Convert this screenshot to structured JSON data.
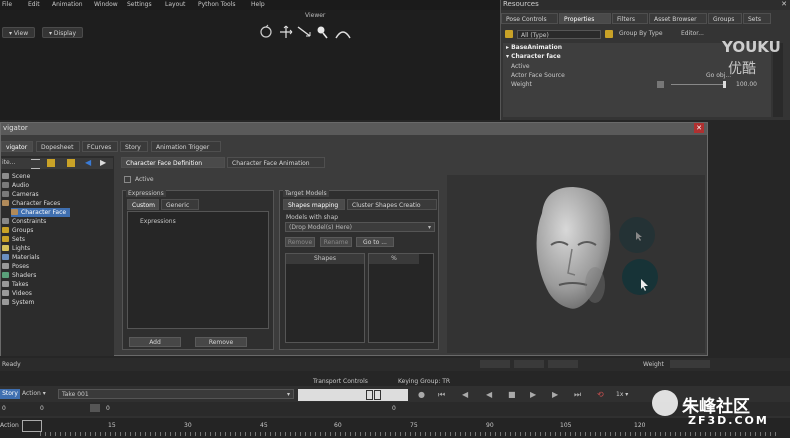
{
  "menu": [
    "File",
    "Edit",
    "Animation",
    "Window",
    "Settings",
    "Layout",
    "Python Tools",
    "Help"
  ],
  "viewer": {
    "title": "Viewer",
    "view_label": "View",
    "display_label": "Display"
  },
  "resources": {
    "title": "Resources",
    "tabs": [
      "Pose Controls",
      "Properties",
      "Filters",
      "Asset Browser",
      "Groups",
      "Sets"
    ],
    "filter_value": "All (Type)",
    "group_value": "Group By Type",
    "editor_label": "Editor...",
    "rows": {
      "base_animation": "BaseAnimation",
      "character_face": "Character face",
      "active": "Active",
      "actor_face_source": "Actor Face Source",
      "actor_face_value": "Go obj...",
      "weight": "Weight",
      "weight_value": "100.00"
    }
  },
  "watermark": {
    "youku_latin": "YOUKU",
    "youku_cn": "优酷",
    "zf3d_cn": "朱峰社区",
    "zf3d_url": "ZF3D.COM"
  },
  "navigator": {
    "title": "vigator",
    "tabs": [
      "vigator",
      "Dopesheet",
      "FCurves",
      "Story",
      "Animation Trigger"
    ],
    "search_label": "ite...",
    "tree": [
      "Scene",
      "Audio",
      "Cameras",
      "Character Faces",
      "Character Face",
      "Constraints",
      "Groups",
      "Sets",
      "Lights",
      "Materials",
      "Poses",
      "Shaders",
      "Takes",
      "Videos",
      "System"
    ],
    "subtabs": [
      "Character Face Definition",
      "Character Face Animation"
    ],
    "active_label": "Active",
    "expressions": {
      "title": "Expressions",
      "tabs": [
        "Custom",
        "Generic"
      ],
      "list_header": "Expressions",
      "add_label": "Add",
      "remove_label": "Remove"
    },
    "targets": {
      "title": "Target Models",
      "tabs": [
        "Shapes mapping",
        "Cluster Shapes Creatio"
      ],
      "models_label": "Models with shap",
      "drop_placeholder": "(Drop Model(s) Here)",
      "remove_label": "Remove",
      "rename_label": "Rename",
      "goto_label": "Go to ...",
      "col_shapes": "Shapes",
      "col_percent": "%"
    }
  },
  "status": {
    "text": "Ready",
    "weight_label": "Weight"
  },
  "transport": {
    "title": "Transport Controls",
    "keying_group": "Keying Group: TR",
    "story_label": "Story",
    "action_label": "Action",
    "take_label": "Take 001",
    "frame_a": "0",
    "frame_b": "0",
    "right_frame": "0",
    "speed": "1x",
    "ruler_prefix": "Action",
    "ruler_ticks": [
      "15",
      "30",
      "45",
      "60",
      "75",
      "90",
      "105",
      "120"
    ],
    "ruler_row_label": "0"
  }
}
